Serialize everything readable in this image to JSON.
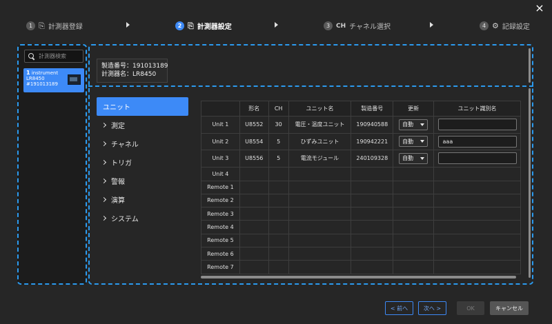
{
  "close_icon": "×",
  "steps": [
    {
      "num": "1",
      "icon": "instrument-icon",
      "label": "計測器登録",
      "active": false
    },
    {
      "num": "2",
      "icon": "instrument-settings-icon",
      "label": "計測器設定",
      "active": true
    },
    {
      "num": "3",
      "icon": "CH",
      "label": "チャネル選択",
      "active": false
    },
    {
      "num": "4",
      "icon": "record-settings-icon",
      "label": "記録設定",
      "active": false
    }
  ],
  "sidebar": {
    "search_placeholder": "計測器検索",
    "instrument": {
      "count": "1",
      "type": "instrument",
      "model": "LR8450",
      "serial": "#191013189"
    }
  },
  "header": {
    "serial_line": "製造番号：191013189",
    "name_line": "計測器名：LR8450"
  },
  "nav": [
    {
      "label": "ユニット",
      "active": true
    },
    {
      "label": "測定",
      "active": false
    },
    {
      "label": "チャネル",
      "active": false
    },
    {
      "label": "トリガ",
      "active": false
    },
    {
      "label": "警報",
      "active": false
    },
    {
      "label": "演算",
      "active": false
    },
    {
      "label": "システム",
      "active": false
    }
  ],
  "table": {
    "headers": [
      "",
      "形名",
      "CH",
      "ユニット名",
      "製造番号",
      "更新",
      "ユニット識別名"
    ],
    "rows": [
      {
        "slot": "Unit 1",
        "model": "U8552",
        "ch": "30",
        "name": "電圧・温度ユニット",
        "serial": "190940588",
        "update": "自動",
        "uid": ""
      },
      {
        "slot": "Unit 2",
        "model": "U8554",
        "ch": "5",
        "name": "ひずみユニット",
        "serial": "190942221",
        "update": "自動",
        "uid": "aaa"
      },
      {
        "slot": "Unit 3",
        "model": "U8556",
        "ch": "5",
        "name": "電流モジュール",
        "serial": "240109328",
        "update": "自動",
        "uid": ""
      },
      {
        "slot": "Unit 4",
        "model": "",
        "ch": "",
        "name": "",
        "serial": "",
        "update": "",
        "uid": null
      },
      {
        "slot": "Remote 1",
        "model": "",
        "ch": "",
        "name": "",
        "serial": "",
        "update": "",
        "uid": null
      },
      {
        "slot": "Remote 2",
        "model": "",
        "ch": "",
        "name": "",
        "serial": "",
        "update": "",
        "uid": null
      },
      {
        "slot": "Remote 3",
        "model": "",
        "ch": "",
        "name": "",
        "serial": "",
        "update": "",
        "uid": null
      },
      {
        "slot": "Remote 4",
        "model": "",
        "ch": "",
        "name": "",
        "serial": "",
        "update": "",
        "uid": null
      },
      {
        "slot": "Remote 5",
        "model": "",
        "ch": "",
        "name": "",
        "serial": "",
        "update": "",
        "uid": null
      },
      {
        "slot": "Remote 6",
        "model": "",
        "ch": "",
        "name": "",
        "serial": "",
        "update": "",
        "uid": null
      },
      {
        "slot": "Remote 7",
        "model": "",
        "ch": "",
        "name": "",
        "serial": "",
        "update": "",
        "uid": null
      }
    ]
  },
  "footer": {
    "prev": "< 前へ",
    "next": "次へ >",
    "ok": "OK",
    "cancel": "キャンセル"
  },
  "colors": {
    "accent": "#3d8af7",
    "dashed_highlight": "#2b9bf0",
    "background": "#262626"
  }
}
